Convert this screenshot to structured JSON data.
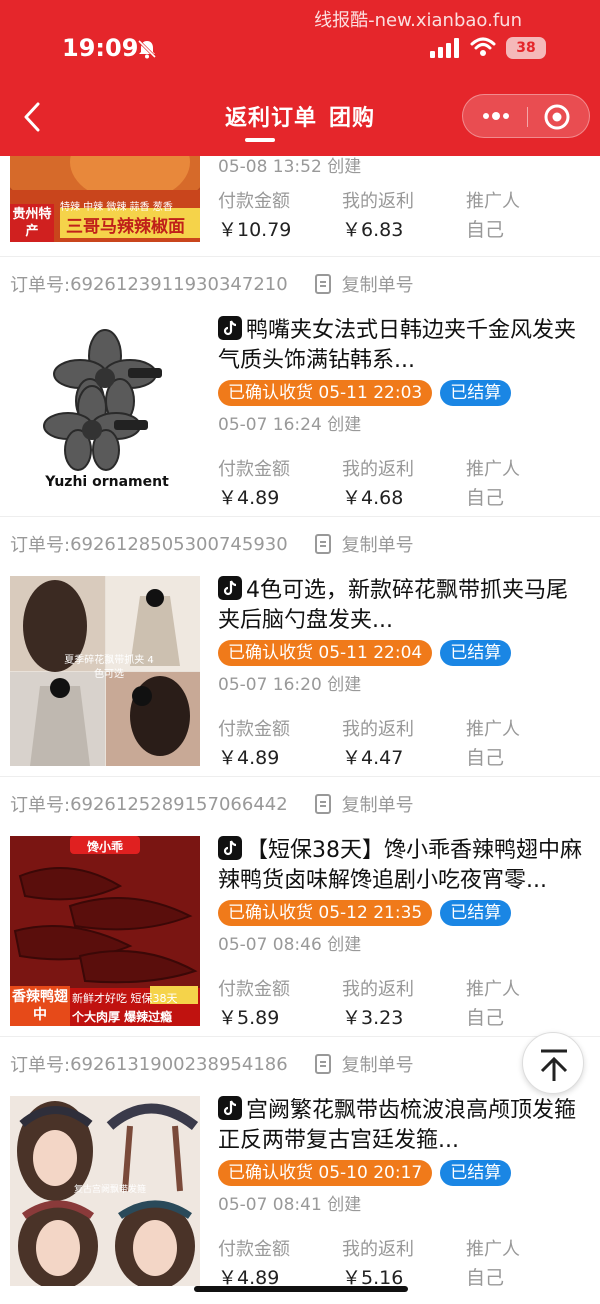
{
  "status_bar": {
    "time": "19:09",
    "battery": "38",
    "watermark": "线报酷-new.xianbao.fun"
  },
  "nav": {
    "title_a": "返利订单",
    "title_b": "团购"
  },
  "column_labels": {
    "pay": "付款金额",
    "rebate": "我的返利",
    "promoter": "推广人"
  },
  "copy_label": "复制单号",
  "order_prefix": "订单号:",
  "partial_order": {
    "created": "05-08 13:52 创建",
    "pay": "￥10.79",
    "rebate": "￥6.83",
    "promoter": "自己",
    "thumb_text": {
      "badge": "贵州特产",
      "name": "三哥马辣辣椒面",
      "flavors": "特辣 中辣 微辣 蒜香 葱香"
    }
  },
  "orders": [
    {
      "order_no": "6926123911930347210",
      "title": "鸭嘴夹女法式日韩边夹千金风发夹气质头饰满钻韩系...",
      "confirm": "已确认收货 05-11 22:03",
      "settle": "已结算",
      "created": "05-07 16:24 创建",
      "pay": "￥4.89",
      "rebate": "￥4.68",
      "promoter": "自己",
      "thumb_text": "Yuzhi ornament"
    },
    {
      "order_no": "6926128505300745930",
      "title": "4色可选，新款碎花飘带抓夹马尾夹后脑勺盘发夹...",
      "confirm": "已确认收货 05-11 22:04",
      "settle": "已结算",
      "created": "05-07 16:20 创建",
      "pay": "￥4.89",
      "rebate": "￥4.47",
      "promoter": "自己",
      "thumb_text": "夏季碎花飘带抓夹 4色可选"
    },
    {
      "order_no": "6926125289157066442",
      "title": "【短保38天】馋小乖香辣鸭翅中麻辣鸭货卤味解馋追剧小吃夜宵零...",
      "confirm": "已确认收货 05-12 21:35",
      "settle": "已结算",
      "created": "05-07 08:46 创建",
      "pay": "￥5.89",
      "rebate": "￥3.23",
      "promoter": "自己",
      "thumb_text": {
        "brand": "馋小乖",
        "badge": "香辣鸭翅中",
        "line1": "新鲜才好吃 短保38天",
        "line2": "个大肉厚 爆辣过瘾"
      }
    },
    {
      "order_no": "6926131900238954186",
      "title": "宫阙繁花飘带齿梳波浪高颅顶发箍正反两带复古宫廷发箍...",
      "confirm": "已确认收货 05-10 20:17",
      "settle": "已结算",
      "created": "05-07 08:41 创建",
      "pay": "￥4.89",
      "rebate": "￥5.16",
      "promoter": "自己",
      "thumb_text": "复古宫阙飘带发箍"
    }
  ],
  "colors": {
    "brand_red": "#e5262b",
    "confirm_orange": "#f07a1a",
    "settle_blue": "#1a86e4"
  }
}
